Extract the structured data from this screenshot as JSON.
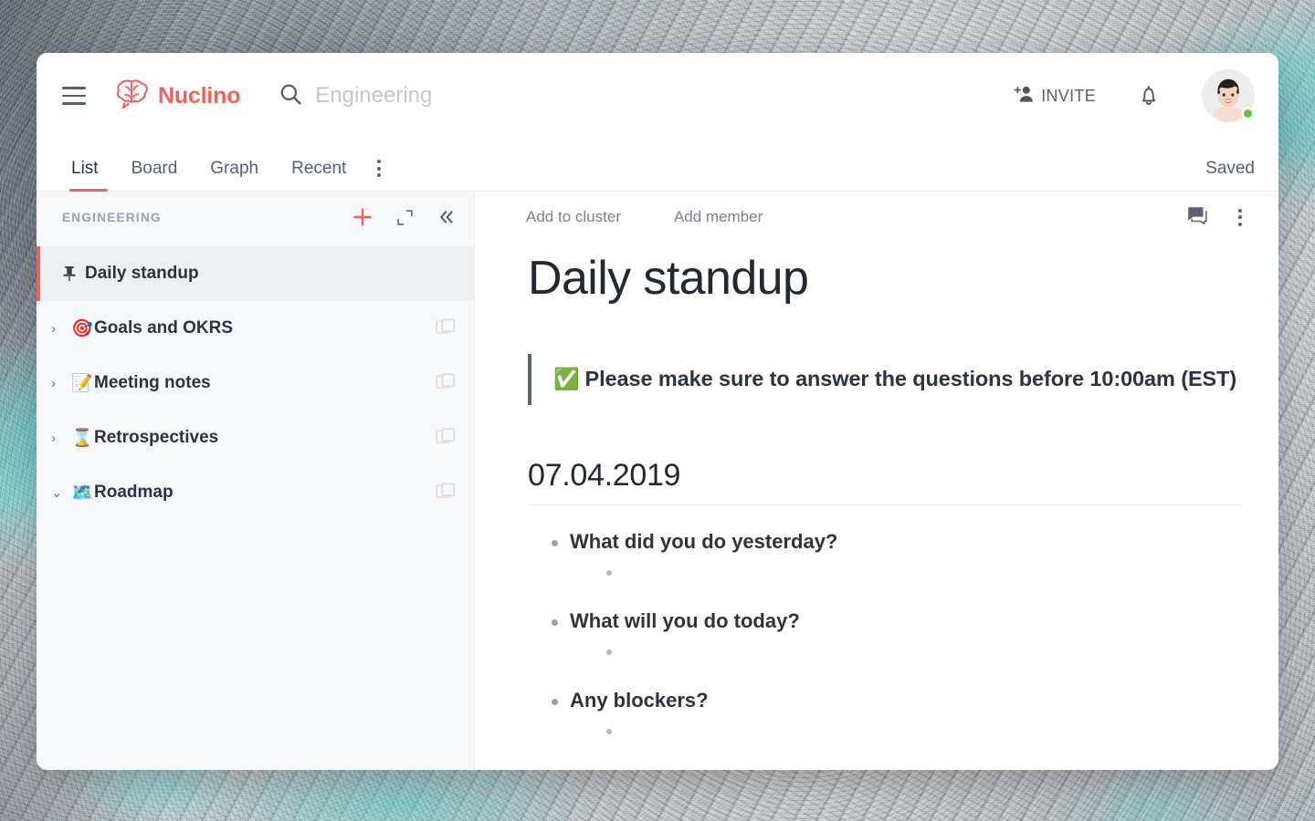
{
  "app": {
    "brand_name": "Nuclino",
    "brand_color": "#f2615c",
    "logo_icon": "brain-speech-bubble-icon"
  },
  "topbar": {
    "menu_icon": "hamburger-menu-icon",
    "search": {
      "icon": "search-icon",
      "value": "",
      "placeholder": "Engineering"
    },
    "invite_label": "INVITE",
    "invite_icon": "person-add-icon",
    "notifications_icon": "bell-icon",
    "avatar_name": "avatar",
    "presence_status_color": "#5ec445"
  },
  "tabbar": {
    "tabs": [
      {
        "label": "List",
        "active": true
      },
      {
        "label": "Board",
        "active": false
      },
      {
        "label": "Graph",
        "active": false
      },
      {
        "label": "Recent",
        "active": false
      }
    ],
    "more_icon": "more-vertical-icon",
    "status_label": "Saved",
    "active_indicator_color": "#f2615c"
  },
  "sidebar": {
    "title": "ENGINEERING",
    "actions": [
      {
        "name": "add-item-button",
        "icon": "plus-icon",
        "color": "#f2615c"
      },
      {
        "name": "expand-button",
        "icon": "expand-corners-icon"
      },
      {
        "name": "collapse-sidebar-button",
        "icon": "chevron-double-left-icon"
      }
    ],
    "items": [
      {
        "label": "Daily standup",
        "emoji": "",
        "icon": "pin-icon",
        "twisty": "",
        "active": true,
        "has_duplicate_icon": false
      },
      {
        "label": "Goals and OKRS",
        "emoji": "🎯",
        "icon": "dart-emoji",
        "twisty": "›",
        "active": false,
        "has_duplicate_icon": true
      },
      {
        "label": "Meeting notes",
        "emoji": "📝",
        "icon": "memo-emoji",
        "twisty": "›",
        "active": false,
        "has_duplicate_icon": true
      },
      {
        "label": "Retrospectives",
        "emoji": "⌛",
        "icon": "hourglass-emoji",
        "twisty": "›",
        "active": false,
        "has_duplicate_icon": true
      },
      {
        "label": "Roadmap",
        "emoji": "🗺️",
        "icon": "map-emoji",
        "twisty": "⌄",
        "active": false,
        "has_duplicate_icon": true
      }
    ]
  },
  "content": {
    "toolbar": {
      "add_to_cluster_label": "Add to cluster",
      "add_member_label": "Add member",
      "comments_icon": "comment-bubble-icon",
      "more_icon": "more-vertical-icon"
    },
    "doc_title": "Daily standup",
    "callout": {
      "emoji": "✅",
      "text": "Please make sure to answer the questions before 10:00am (EST)"
    },
    "date_heading": "07.04.2019",
    "questions": [
      {
        "text": "What did you do yesterday?",
        "answers": [
          ""
        ]
      },
      {
        "text": "What will you do today?",
        "answers": [
          ""
        ]
      },
      {
        "text": "Any blockers?",
        "answers": [
          ""
        ]
      }
    ]
  }
}
